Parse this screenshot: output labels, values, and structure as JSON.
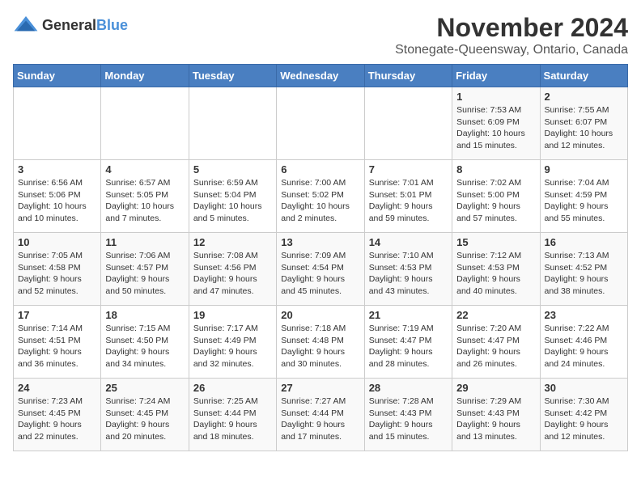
{
  "logo": {
    "general": "General",
    "blue": "Blue"
  },
  "title": "November 2024",
  "location": "Stonegate-Queensway, Ontario, Canada",
  "days_of_week": [
    "Sunday",
    "Monday",
    "Tuesday",
    "Wednesday",
    "Thursday",
    "Friday",
    "Saturday"
  ],
  "weeks": [
    [
      {
        "day": "",
        "info": ""
      },
      {
        "day": "",
        "info": ""
      },
      {
        "day": "",
        "info": ""
      },
      {
        "day": "",
        "info": ""
      },
      {
        "day": "",
        "info": ""
      },
      {
        "day": "1",
        "info": "Sunrise: 7:53 AM\nSunset: 6:09 PM\nDaylight: 10 hours and 15 minutes."
      },
      {
        "day": "2",
        "info": "Sunrise: 7:55 AM\nSunset: 6:07 PM\nDaylight: 10 hours and 12 minutes."
      }
    ],
    [
      {
        "day": "3",
        "info": "Sunrise: 6:56 AM\nSunset: 5:06 PM\nDaylight: 10 hours and 10 minutes."
      },
      {
        "day": "4",
        "info": "Sunrise: 6:57 AM\nSunset: 5:05 PM\nDaylight: 10 hours and 7 minutes."
      },
      {
        "day": "5",
        "info": "Sunrise: 6:59 AM\nSunset: 5:04 PM\nDaylight: 10 hours and 5 minutes."
      },
      {
        "day": "6",
        "info": "Sunrise: 7:00 AM\nSunset: 5:02 PM\nDaylight: 10 hours and 2 minutes."
      },
      {
        "day": "7",
        "info": "Sunrise: 7:01 AM\nSunset: 5:01 PM\nDaylight: 9 hours and 59 minutes."
      },
      {
        "day": "8",
        "info": "Sunrise: 7:02 AM\nSunset: 5:00 PM\nDaylight: 9 hours and 57 minutes."
      },
      {
        "day": "9",
        "info": "Sunrise: 7:04 AM\nSunset: 4:59 PM\nDaylight: 9 hours and 55 minutes."
      }
    ],
    [
      {
        "day": "10",
        "info": "Sunrise: 7:05 AM\nSunset: 4:58 PM\nDaylight: 9 hours and 52 minutes."
      },
      {
        "day": "11",
        "info": "Sunrise: 7:06 AM\nSunset: 4:57 PM\nDaylight: 9 hours and 50 minutes."
      },
      {
        "day": "12",
        "info": "Sunrise: 7:08 AM\nSunset: 4:56 PM\nDaylight: 9 hours and 47 minutes."
      },
      {
        "day": "13",
        "info": "Sunrise: 7:09 AM\nSunset: 4:54 PM\nDaylight: 9 hours and 45 minutes."
      },
      {
        "day": "14",
        "info": "Sunrise: 7:10 AM\nSunset: 4:53 PM\nDaylight: 9 hours and 43 minutes."
      },
      {
        "day": "15",
        "info": "Sunrise: 7:12 AM\nSunset: 4:53 PM\nDaylight: 9 hours and 40 minutes."
      },
      {
        "day": "16",
        "info": "Sunrise: 7:13 AM\nSunset: 4:52 PM\nDaylight: 9 hours and 38 minutes."
      }
    ],
    [
      {
        "day": "17",
        "info": "Sunrise: 7:14 AM\nSunset: 4:51 PM\nDaylight: 9 hours and 36 minutes."
      },
      {
        "day": "18",
        "info": "Sunrise: 7:15 AM\nSunset: 4:50 PM\nDaylight: 9 hours and 34 minutes."
      },
      {
        "day": "19",
        "info": "Sunrise: 7:17 AM\nSunset: 4:49 PM\nDaylight: 9 hours and 32 minutes."
      },
      {
        "day": "20",
        "info": "Sunrise: 7:18 AM\nSunset: 4:48 PM\nDaylight: 9 hours and 30 minutes."
      },
      {
        "day": "21",
        "info": "Sunrise: 7:19 AM\nSunset: 4:47 PM\nDaylight: 9 hours and 28 minutes."
      },
      {
        "day": "22",
        "info": "Sunrise: 7:20 AM\nSunset: 4:47 PM\nDaylight: 9 hours and 26 minutes."
      },
      {
        "day": "23",
        "info": "Sunrise: 7:22 AM\nSunset: 4:46 PM\nDaylight: 9 hours and 24 minutes."
      }
    ],
    [
      {
        "day": "24",
        "info": "Sunrise: 7:23 AM\nSunset: 4:45 PM\nDaylight: 9 hours and 22 minutes."
      },
      {
        "day": "25",
        "info": "Sunrise: 7:24 AM\nSunset: 4:45 PM\nDaylight: 9 hours and 20 minutes."
      },
      {
        "day": "26",
        "info": "Sunrise: 7:25 AM\nSunset: 4:44 PM\nDaylight: 9 hours and 18 minutes."
      },
      {
        "day": "27",
        "info": "Sunrise: 7:27 AM\nSunset: 4:44 PM\nDaylight: 9 hours and 17 minutes."
      },
      {
        "day": "28",
        "info": "Sunrise: 7:28 AM\nSunset: 4:43 PM\nDaylight: 9 hours and 15 minutes."
      },
      {
        "day": "29",
        "info": "Sunrise: 7:29 AM\nSunset: 4:43 PM\nDaylight: 9 hours and 13 minutes."
      },
      {
        "day": "30",
        "info": "Sunrise: 7:30 AM\nSunset: 4:42 PM\nDaylight: 9 hours and 12 minutes."
      }
    ]
  ]
}
